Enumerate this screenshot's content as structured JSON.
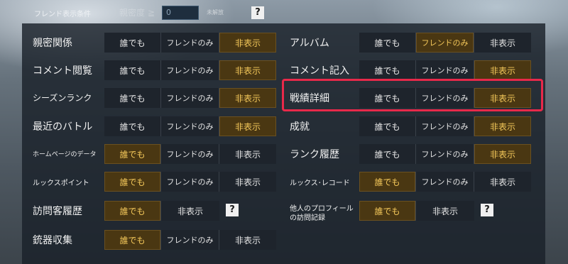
{
  "header": {
    "friend_display_condition": "フレンド表示条件",
    "faint_text": "親密度 ≧",
    "intimacy_value": "0",
    "unset_label": "未解放"
  },
  "options": {
    "anyone": "誰でも",
    "friends_only": "フレンドのみ",
    "hidden": "非表示"
  },
  "left": [
    {
      "label": "親密関係",
      "selected": "hidden"
    },
    {
      "label": "コメント閲覧",
      "selected": "hidden"
    },
    {
      "label": "シーズンランク",
      "selected": "hidden"
    },
    {
      "label": "最近のバトル",
      "selected": "hidden"
    },
    {
      "label": "ホームページのデータ",
      "selected": "anyone"
    },
    {
      "label": "ルックスポイント",
      "selected": "anyone"
    },
    {
      "label": "訪問客履歴",
      "selected": "anyone"
    },
    {
      "label": "銃器収集",
      "selected": "anyone"
    }
  ],
  "right": [
    {
      "label": "アルバム",
      "selected": "friends_only"
    },
    {
      "label": "コメント記入",
      "selected": "hidden"
    },
    {
      "label": "戦績詳細",
      "selected": "hidden"
    },
    {
      "label": "成就",
      "selected": "hidden"
    },
    {
      "label": "ランク履歴",
      "selected": "hidden"
    },
    {
      "label": "ルックス･レコード",
      "selected": "anyone"
    },
    {
      "label_line1": "他人のプロフィール",
      "label_line2": "の訪問記録",
      "selected": "anyone"
    }
  ],
  "help_icon": "?",
  "colors": {
    "selected_bg": "#4a3712",
    "selected_text": "#f4c85a",
    "highlight_border": "#e8294a"
  }
}
